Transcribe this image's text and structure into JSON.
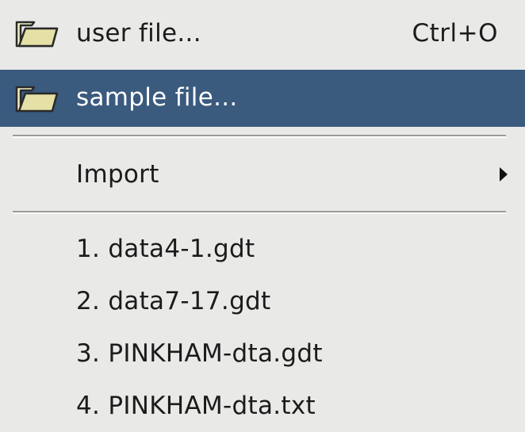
{
  "menu": {
    "items": [
      {
        "label": "user file...",
        "shortcut": "Ctrl+O",
        "icon": "folder-open-icon"
      },
      {
        "label": "sample file...",
        "shortcut": "",
        "icon": "folder-open-icon"
      }
    ],
    "import_label": "Import",
    "recent_files": [
      "1. data4-1.gdt",
      "2. data7-17.gdt",
      "3. PINKHAM-dta.gdt",
      "4. PINKHAM-dta.txt"
    ]
  },
  "colors": {
    "menu_background": "#e9e9e8",
    "highlight_background": "#3a5a7e",
    "highlight_text": "#ffffff",
    "text": "#1b1b1b",
    "folder_fill": "#e5e1a6",
    "folder_outline": "#2a2a2a"
  }
}
